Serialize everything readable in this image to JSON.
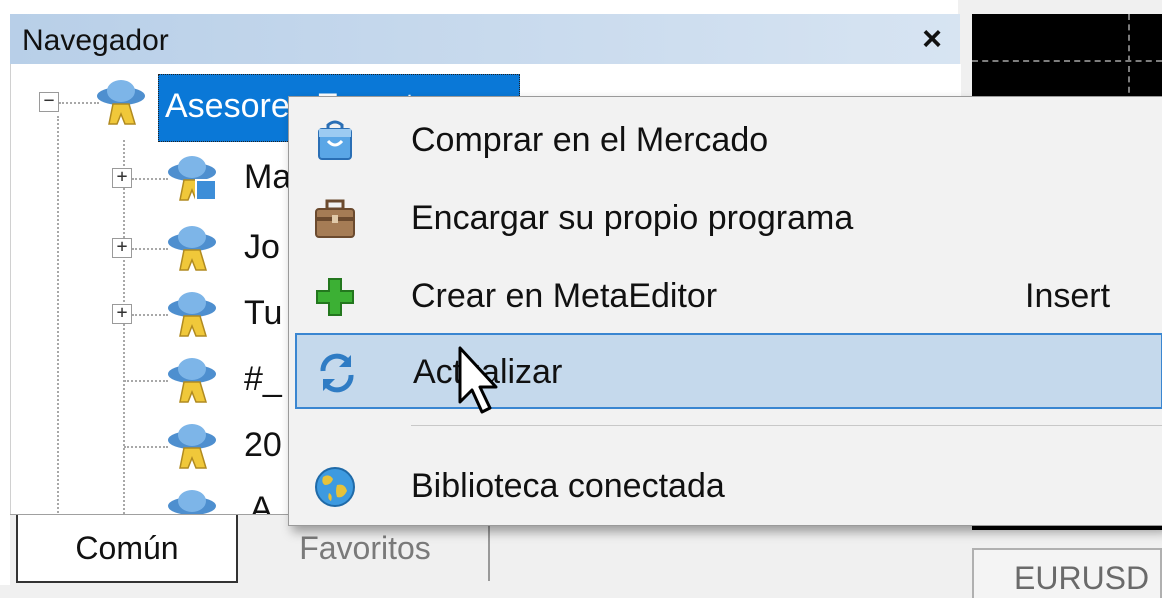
{
  "navigator": {
    "title": "Navegador",
    "close_label": "×",
    "tree": {
      "root_label": "Asesores Expertos",
      "children": [
        {
          "label": "Ma",
          "expandable": true
        },
        {
          "label": "Jo",
          "expandable": true
        },
        {
          "label": "Tu",
          "expandable": true
        },
        {
          "label": "#_",
          "expandable": false
        },
        {
          "label": "20",
          "expandable": false
        },
        {
          "label": "A",
          "expandable": false
        }
      ]
    },
    "tabs": [
      {
        "label": "Común",
        "active": true
      },
      {
        "label": "Favoritos",
        "active": false
      }
    ]
  },
  "chart": {
    "tab_label": "EURUSD"
  },
  "context_menu": {
    "items": [
      {
        "label": "Comprar en el Mercado",
        "icon": "shopping-bag-icon",
        "shortcut": ""
      },
      {
        "label": "Encargar su propio programa",
        "icon": "briefcase-icon",
        "shortcut": ""
      },
      {
        "label": "Crear en MetaEditor",
        "icon": "plus-icon",
        "shortcut": "Insert"
      },
      {
        "label": "Actualizar",
        "icon": "refresh-icon",
        "shortcut": "",
        "highlighted": true
      },
      {
        "label": "Biblioteca conectada",
        "icon": "globe-icon",
        "shortcut": ""
      }
    ]
  },
  "colors": {
    "selection": "#0a78d7",
    "menu_hover": "#c5d9ec",
    "menu_hover_border": "#3a86d1",
    "title_bar": "#c3d6ea"
  }
}
